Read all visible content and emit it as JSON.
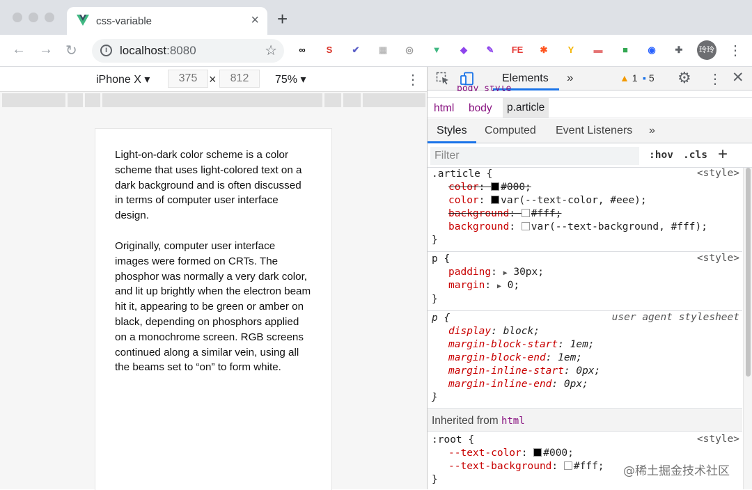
{
  "browser": {
    "tab_title": "css-variable",
    "url_host": "localhost",
    "url_port": ":8080",
    "new_tab_label": "+",
    "tab_close_label": "×",
    "nav": {
      "back": "←",
      "forward": "→",
      "reload": "↻"
    },
    "extensions": [
      {
        "icon": "link-ext-icon",
        "glyph": "∞",
        "color": "#000000"
      },
      {
        "icon": "s-ext-icon",
        "glyph": "S",
        "color": "#d93025"
      },
      {
        "icon": "check-ext-icon",
        "glyph": "✔",
        "color": "#5b5fc7"
      },
      {
        "icon": "grid-ext-icon",
        "glyph": "▦",
        "color": "#bbbbbb"
      },
      {
        "icon": "eye-ext-icon",
        "glyph": "◎",
        "color": "#999999"
      },
      {
        "icon": "vue-ext-icon",
        "glyph": "▼",
        "color": "#41b883"
      },
      {
        "icon": "palette-ext-icon",
        "glyph": "◆",
        "color": "#8e44ec"
      },
      {
        "icon": "feather-ext-icon",
        "glyph": "✎",
        "color": "#8e44ec"
      },
      {
        "icon": "fe-ext-icon",
        "glyph": "FE",
        "color": "#e53935"
      },
      {
        "icon": "star-ext-icon",
        "glyph": "✱",
        "color": "#ff5722"
      },
      {
        "icon": "y-ext-icon",
        "glyph": "Y",
        "color": "#f4b400"
      },
      {
        "icon": "pdf-ext-icon",
        "glyph": "▬",
        "color": "#e57373"
      },
      {
        "icon": "square-ext-icon",
        "glyph": "■",
        "color": "#34a853"
      },
      {
        "icon": "rocket-ext-icon",
        "glyph": "◉",
        "color": "#2962ff"
      },
      {
        "icon": "puzzle-ext-icon",
        "glyph": "✚",
        "color": "#5f6368"
      }
    ],
    "avatar_text": "玲玲",
    "menu_glyph": "⋮"
  },
  "device_toolbar": {
    "device": "iPhone X ▾",
    "width": "375",
    "height": "812",
    "times": "×",
    "zoom": "75% ▾",
    "menu_glyph": "⋮"
  },
  "article": {
    "paragraph_1": "Light-on-dark color scheme is a color scheme that uses light-colored text on a dark background and is often discussed in terms of computer user interface design.",
    "paragraph_2": "Originally, computer user interface images were formed on CRTs. The phosphor was normally a very dark color, and lit up brightly when the electron beam hit it, appearing to be green or amber on black, depending on phosphors applied on a monochrome screen. RGB screens continued along a similar vein, using all the beams set to “on” to form white."
  },
  "devtools": {
    "panel_tab": "Elements",
    "more_tabs": "»",
    "warnings_count": "1",
    "messages_count": "5",
    "gear_glyph": "⚙",
    "menu_glyph": "⋮",
    "close_glyph": "✕",
    "cut_line": "body style",
    "breadcrumbs": [
      "html",
      "body",
      "p.article"
    ],
    "sub_tabs": [
      "Styles",
      "Computed",
      "Event Listeners",
      "»"
    ],
    "filter_placeholder": "Filter",
    "hov": ":hov",
    "cls": ".cls",
    "add": "+",
    "rules": {
      "article": {
        "selector": ".article {",
        "source": "<style>",
        "decls": [
          {
            "prop": "color",
            "value": "#000;",
            "struck": true,
            "swatch": "#000000"
          },
          {
            "prop": "color",
            "value": "var(--text-color, #eee);",
            "struck": false,
            "swatch": "#000000"
          },
          {
            "prop": "background",
            "value": "#fff;",
            "struck": true,
            "swatch": "#ffffff"
          },
          {
            "prop": "background",
            "value": "var(--text-background, #fff);",
            "struck": false,
            "swatch": "#ffffff"
          }
        ],
        "close": "}"
      },
      "p": {
        "selector": "p {",
        "source": "<style>",
        "decls": [
          {
            "prop": "padding",
            "value": "30px;"
          },
          {
            "prop": "margin",
            "value": "0;"
          }
        ],
        "close": "}"
      },
      "ua": {
        "selector": "p {",
        "source": "user agent stylesheet",
        "decls": [
          {
            "prop": "display",
            "value": "block;"
          },
          {
            "prop": "margin-block-start",
            "value": "1em;"
          },
          {
            "prop": "margin-block-end",
            "value": "1em;"
          },
          {
            "prop": "margin-inline-start",
            "value": "0px;"
          },
          {
            "prop": "margin-inline-end",
            "value": "0px;"
          }
        ],
        "close": "}"
      },
      "inherited_label": "Inherited from",
      "inherited_tag": "html",
      "root": {
        "selector": ":root {",
        "source": "<style>",
        "decls": [
          {
            "prop": "--text-color",
            "value": "#000;",
            "swatch": "#000000"
          },
          {
            "prop": "--text-background",
            "value": "#fff;",
            "swatch": "#ffffff"
          }
        ],
        "close": "}"
      }
    }
  },
  "watermark": "@稀土掘金技术社区"
}
